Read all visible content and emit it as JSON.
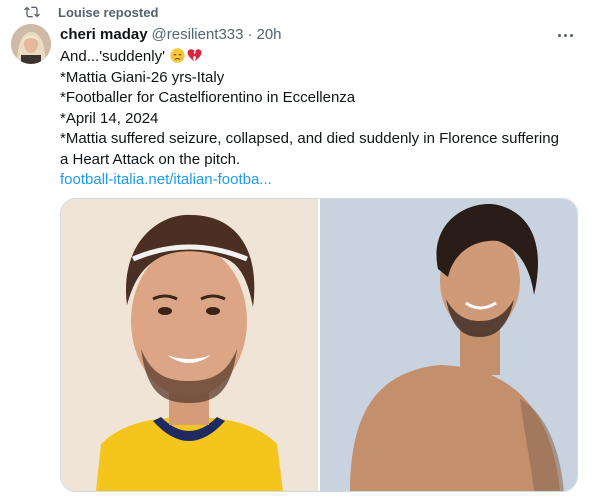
{
  "repost": {
    "label": "Louise reposted",
    "icon": "repost-icon"
  },
  "author": {
    "name": "cheri maday",
    "handle": "@resilient333",
    "separator": "·",
    "time": "20h",
    "avatar_icon": "avatar"
  },
  "tweet": {
    "line1": "And...'suddenly'",
    "line1_emojis": [
      "disappointed-relieved-face",
      "broken-heart"
    ],
    "line2": "*Mattia Giani-26 yrs-Italy",
    "line3": "*Footballer for Castelfiorentino in Eccellenza",
    "line4": "*April 14, 2024",
    "line5": "*Mattia suffered seizure, collapsed, and died suddenly in Florence suffering",
    "line6": "a Heart Attack on the pitch.",
    "link": "football-italia.net/italian-footba..."
  },
  "media": {
    "photo_left": "man-in-yellow-jersey-photo",
    "photo_right": "shirtless-man-photo"
  },
  "colors": {
    "link": "#1d9bf0",
    "muted": "#536471",
    "text": "#0f1419",
    "border": "#cfd9de"
  }
}
